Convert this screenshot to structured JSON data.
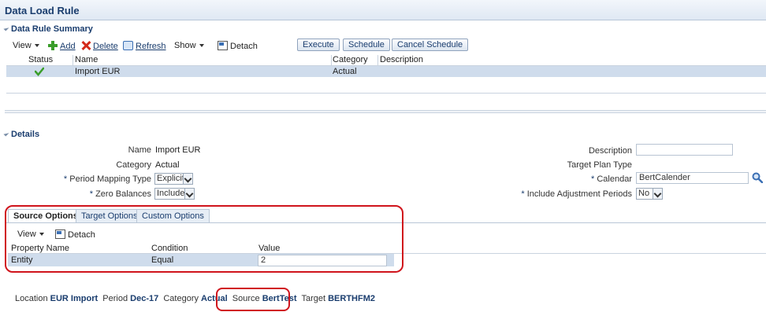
{
  "title": "Data Load Rule",
  "summary": {
    "header": "Data Rule Summary",
    "toolbar": {
      "view": "View",
      "add": "Add",
      "delete": "Delete",
      "refresh": "Refresh",
      "show": "Show",
      "detach": "Detach",
      "execute": "Execute",
      "schedule": "Schedule",
      "cancel_schedule": "Cancel Schedule"
    },
    "columns": [
      "Status",
      "Name",
      "Category",
      "Description"
    ],
    "rows": [
      {
        "status": "check-icon",
        "name": "Import EUR",
        "category": "Actual",
        "description": ""
      }
    ]
  },
  "details": {
    "header": "Details",
    "name_label": "Name",
    "name_value": "Import EUR",
    "category_label": "Category",
    "category_value": "Actual",
    "period_mapping_label": "Period Mapping Type",
    "period_mapping_value": "Explicit",
    "zero_balances_label": "Zero Balances",
    "zero_balances_value": "Include",
    "description_label": "Description",
    "description_value": "",
    "target_plan_type_label": "Target Plan Type",
    "calendar_label": "Calendar",
    "calendar_value": "BertCalender",
    "include_adj_label": "Include Adjustment Periods",
    "include_adj_value": "No",
    "req": "*"
  },
  "tabs": {
    "items": [
      "Source Options",
      "Target Options",
      "Custom Options"
    ],
    "active": "Source Options",
    "toolbar": {
      "view": "View",
      "detach": "Detach"
    },
    "columns": [
      "Property Name",
      "Condition",
      "Value"
    ],
    "row": {
      "property": "Entity",
      "condition": "Equal",
      "value": "2"
    }
  },
  "footer": {
    "location_label": "Location",
    "location_value": "EUR Import",
    "period_label": "Period",
    "period_value": "Dec-17",
    "category_label": "Category",
    "category_value": "Actual",
    "source_label": "Source",
    "source_value": "BertTest",
    "target_label": "Target",
    "target_value": "BERTHFM2"
  },
  "colors": {
    "accent": "#1a3d6e",
    "highlight": "#d0141c",
    "selected_row": "#cfdcec",
    "ok": "#3a9d2a"
  }
}
